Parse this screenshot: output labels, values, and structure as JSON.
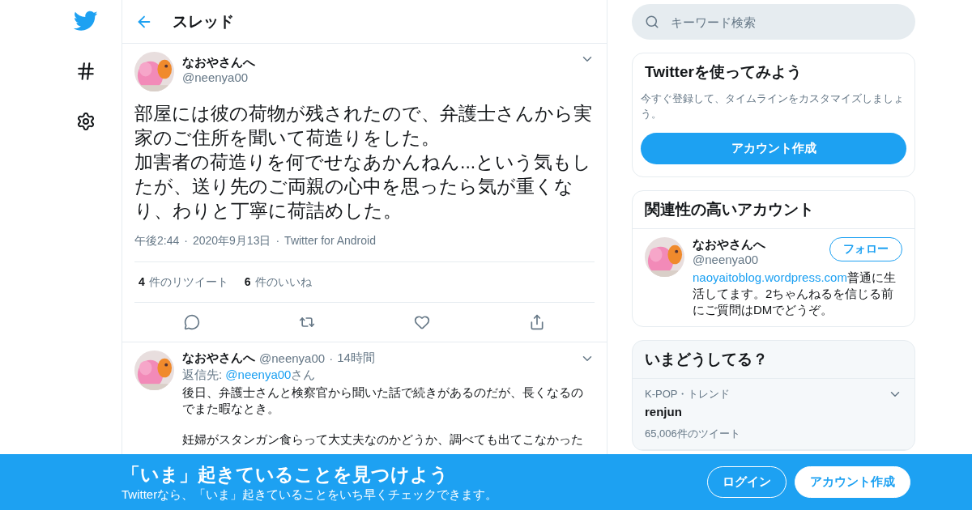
{
  "nav": {
    "items": [
      {
        "kind": "logo"
      },
      {
        "kind": "hash"
      },
      {
        "kind": "settings"
      }
    ]
  },
  "header": {
    "title": "スレッド"
  },
  "tweet": {
    "name": "なおやさんへ",
    "handle": "@neenya00",
    "text": [
      "部屋には彼の荷物が残されたので、弁護士さんから実家のご住所を聞いて荷造りをした。",
      "加害者の荷造りを何でせなあかんねん...という気もしたが、送り先のご両親の心中を思ったら気が重くなり、わりと丁寧に荷詰めした。"
    ],
    "separator": "·",
    "time": "午後2:44",
    "date": "2020年9月13日",
    "source": "Twitter for Android",
    "stats": [
      {
        "count": "4",
        "label": "件のリツイート"
      },
      {
        "count": "6",
        "label": "件のいいね"
      }
    ],
    "actions": [
      {
        "kind": "reply"
      },
      {
        "kind": "retweet"
      },
      {
        "kind": "like"
      },
      {
        "kind": "share"
      }
    ]
  },
  "reply": {
    "name": "なおやさんへ",
    "handle": "@neenya00",
    "separator": "·",
    "time": "14時間",
    "reply_prefix": "返信先: ",
    "reply_to": "@neenya00",
    "reply_suffix": "さん",
    "paragraphs": [
      "後日、弁護士さんと検察官から聞いた話で続きがあるのだが、長くなるのでまた暇なとき。",
      "妊婦がスタンガン食らって大丈夫なのかどうか、調べても出てこなかった"
    ]
  },
  "search": {
    "placeholder": "キーワード検索"
  },
  "signup_card": {
    "title": "Twitterを使ってみよう",
    "text": "今すぐ登録して、タイムラインをカスタマイズしましょう。",
    "button": "アカウント作成"
  },
  "related": {
    "title": "関連性の高いアカウント",
    "accounts": [
      {
        "name": "なおやさんへ",
        "handle": "@neenya00",
        "button": "フォロー",
        "link": "naoyaitoblog.wordpress.com",
        "bio": "普通に生活してます。2ちゃんねるを信じる前にご質問はDMでどうぞ。"
      }
    ]
  },
  "trends": {
    "title": "いまどうしてる？",
    "items": [
      {
        "context": "K-POP・トレンド",
        "name": "renjun",
        "count": "65,006件のツイート"
      }
    ]
  },
  "banner": {
    "title": "「いま」起きていることを見つけよう",
    "subtitle": "Twitterなら、「いま」起きていることをいち早くチェックできます。",
    "buttons": [
      {
        "label": "ログイン",
        "kind": "outline"
      },
      {
        "label": "アカウント作成",
        "kind": "solid"
      }
    ]
  }
}
